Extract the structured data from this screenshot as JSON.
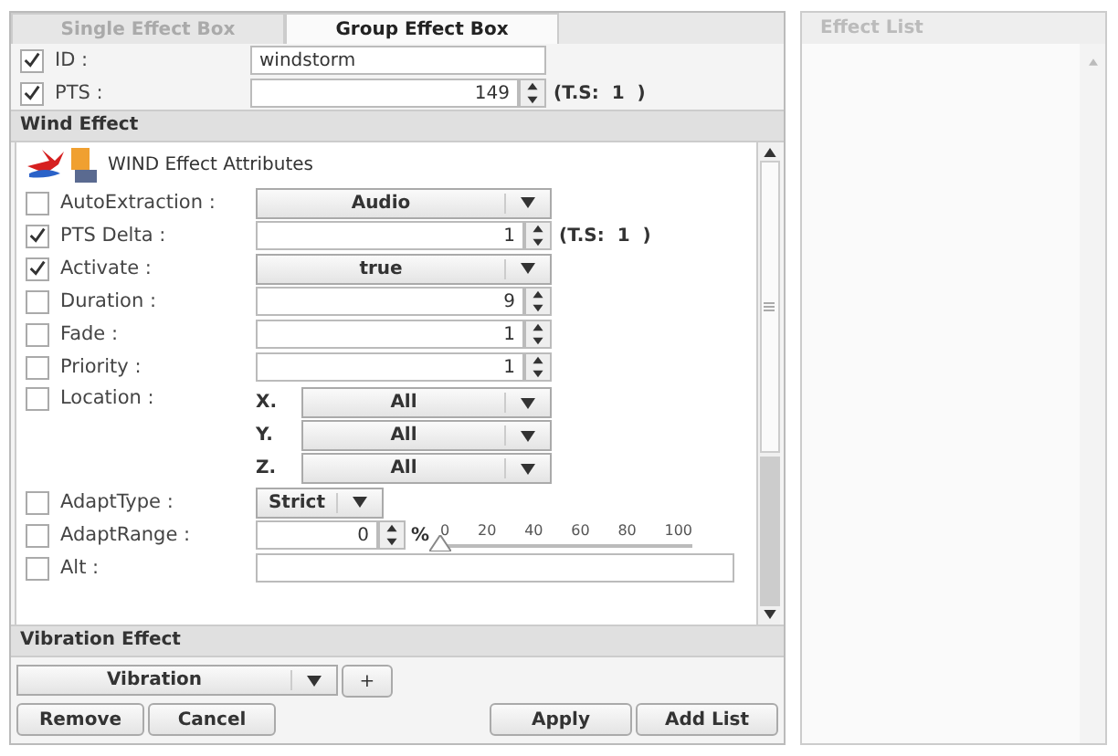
{
  "tabs": [
    {
      "label": "Single Effect Box",
      "selected": false
    },
    {
      "label": "Group Effect Box",
      "selected": true
    }
  ],
  "header_fields": [
    {
      "label": "ID :",
      "checked": true,
      "kind": "text",
      "value": "windstorm"
    },
    {
      "label": "PTS :",
      "checked": true,
      "kind": "spin",
      "value": "149",
      "suffix": "(T.S:  1  )"
    }
  ],
  "wind_effect": {
    "title": "Wind Effect",
    "attributes_title": "WIND Effect Attributes",
    "rows": [
      {
        "label": "AutoExtraction :",
        "checked": false,
        "kind": "select",
        "value": "Audio"
      },
      {
        "label": "PTS Delta :",
        "checked": true,
        "kind": "spin",
        "value": "1",
        "suffix": "(T.S:  1  )"
      },
      {
        "label": "Activate :",
        "checked": true,
        "kind": "select",
        "value": "true"
      },
      {
        "label": "Duration :",
        "checked": false,
        "kind": "spin",
        "value": "9"
      },
      {
        "label": "Fade :",
        "checked": false,
        "kind": "spin",
        "value": "1"
      },
      {
        "label": "Priority :",
        "checked": false,
        "kind": "spin",
        "value": "1"
      },
      {
        "label": "Location :",
        "checked": false,
        "kind": "location",
        "axes": [
          {
            "label": "X.",
            "value": "All"
          },
          {
            "label": "Y.",
            "value": "All"
          },
          {
            "label": "Z.",
            "value": "All"
          }
        ]
      },
      {
        "label": "AdaptType :",
        "checked": false,
        "kind": "small_select",
        "value": "Strict"
      },
      {
        "label": "AdaptRange :",
        "checked": false,
        "kind": "range",
        "value": "0",
        "unit": "%",
        "ticks": [
          "0",
          "20",
          "40",
          "60",
          "80",
          "100"
        ],
        "level": 0
      },
      {
        "label": "Alt :",
        "checked": false,
        "kind": "text"
      }
    ]
  },
  "vibration_effect": {
    "title": "Vibration Effect",
    "effect_select": "Vibration",
    "add_button": "+"
  },
  "buttons_left": [
    "Remove",
    "Cancel"
  ],
  "buttons_right": [
    "Apply",
    "Add List"
  ],
  "effect_list": {
    "title": "Effect List"
  }
}
